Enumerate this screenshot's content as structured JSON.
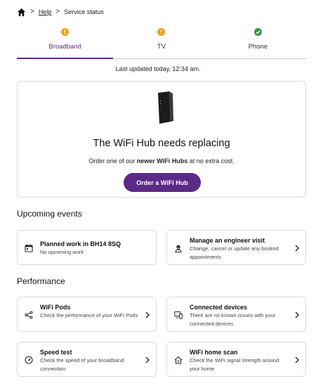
{
  "breadcrumb": {
    "home_icon": "home-icon",
    "help": "Help",
    "current": "Service status",
    "separator": ">"
  },
  "tabs": [
    {
      "label": "Broadband",
      "status": "warning",
      "active": true
    },
    {
      "label": "TV",
      "status": "warning",
      "active": false
    },
    {
      "label": "Phone",
      "status": "ok",
      "active": false
    }
  ],
  "colors": {
    "accent": "#5b2a86",
    "warning": "#f0a020",
    "ok": "#2e9a3e"
  },
  "last_updated": "Last updated today, 12:34 am.",
  "hero": {
    "title": "The WiFi Hub needs replacing",
    "text_before": "Order one of our ",
    "text_bold": "newer WiFi Hubs",
    "text_after": " at no extra cost.",
    "button": "Order a WiFi Hub"
  },
  "upcoming": {
    "heading": "Upcoming events",
    "cards": [
      {
        "icon": "calendar-icon",
        "title": "Planned work in BH14 8SQ",
        "desc": "No upcoming work",
        "has_chevron": false
      },
      {
        "icon": "engineer-icon",
        "title": "Manage an engineer visit",
        "desc": "Change, cancel or update any booked appointments",
        "has_chevron": true
      }
    ]
  },
  "performance": {
    "heading": "Performance",
    "cards": [
      {
        "icon": "share-nodes-icon",
        "title": "WiFi Pods",
        "desc": "Check the performance of your WiFi Pods"
      },
      {
        "icon": "devices-icon",
        "title": "Connected devices",
        "desc": "There are no known issues with your connected devices"
      },
      {
        "icon": "speedometer-icon",
        "title": "Speed test",
        "desc": "Check the speed of your broadband connection"
      },
      {
        "icon": "wifi-home-icon",
        "title": "WiFi home scan",
        "desc": "Check the WiFi signal strength around your home"
      }
    ]
  }
}
